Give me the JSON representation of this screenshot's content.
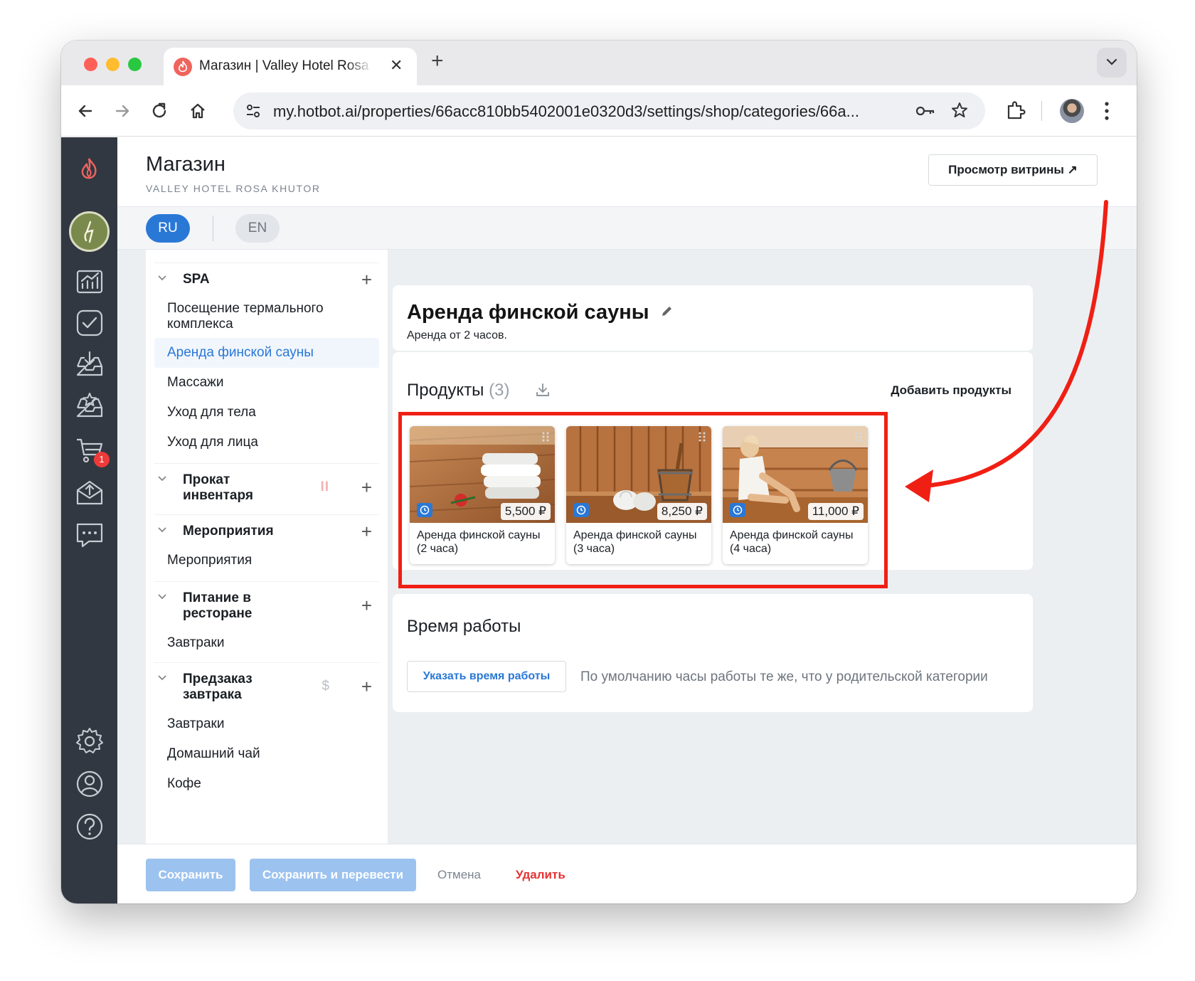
{
  "browser": {
    "tab_title": "Магазин | Valley Hotel Rosa Khutor",
    "url_host": "my.hotbot.ai",
    "url_path": "/properties/66acc810bb5402001e0320d3/settings/shop/categories/66a..."
  },
  "header": {
    "title": "Магазин",
    "subtitle": "VALLEY HOTEL ROSA KHUTOR",
    "preview_label": "Просмотр витрины ↗"
  },
  "languages": {
    "active": "RU",
    "other": "EN"
  },
  "rail": {
    "cart_badge": "1"
  },
  "tree": {
    "groups": [
      {
        "label": "SPA",
        "items": [
          "Посещение термального комплекса",
          "Аренда финской сауны",
          "Массажи",
          "Уход для тела",
          "Уход для лица"
        ]
      },
      {
        "label": "Прокат инвентаря",
        "extra": "II",
        "items": []
      },
      {
        "label": "Мероприятия",
        "items": [
          "Мероприятия"
        ]
      },
      {
        "label": "Питание в ресторане",
        "items": [
          "Завтраки"
        ]
      },
      {
        "label": "Предзаказ завтрака",
        "extra": "$",
        "items": [
          "Завтраки",
          "Домашний чай",
          "Кофе"
        ]
      }
    ],
    "plus": "+"
  },
  "category": {
    "title": "Аренда финской сауны",
    "description": "Аренда от 2 часов."
  },
  "products": {
    "title": "Продукты",
    "count": "(3)",
    "add_label": "Добавить продукты",
    "items": [
      {
        "name": "Аренда финской сауны (2 часа)",
        "price": "5,500 ₽"
      },
      {
        "name": "Аренда финской сауны (3 часа)",
        "price": "8,250 ₽"
      },
      {
        "name": "Аренда финской сауны (4 часа)",
        "price": "11,000 ₽"
      }
    ]
  },
  "hours": {
    "title": "Время работы",
    "button_label": "Указать время работы",
    "note": "По умолчанию часы работы те же, что у родительской категории"
  },
  "footer": {
    "save": "Сохранить",
    "save_translate": "Сохранить и перевести",
    "cancel": "Отмена",
    "delete": "Удалить"
  },
  "colors": {
    "accent": "#2a78d6",
    "highlight": "#f01f14",
    "rail": "#323841",
    "danger": "#e53232"
  }
}
